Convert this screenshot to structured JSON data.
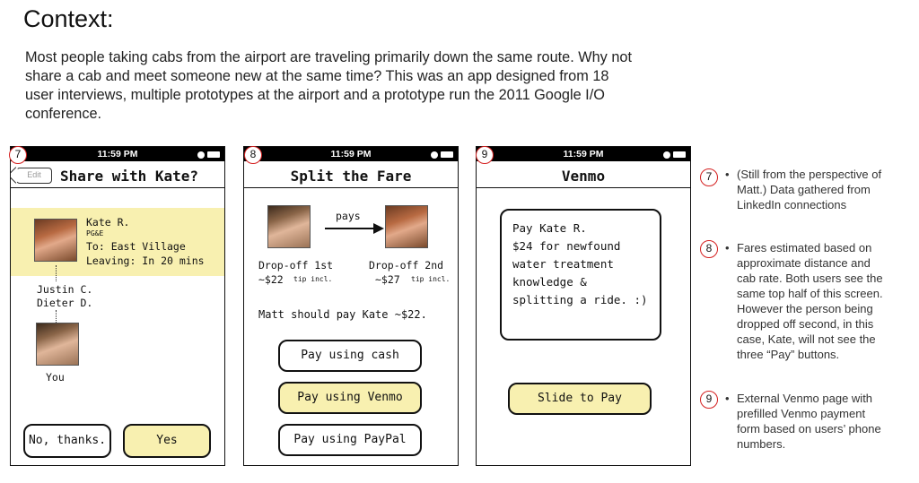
{
  "context": {
    "title": "Context:",
    "body": "Most people taking cabs from the airport are traveling primarily down the same route. Why not share a cab and meet someone new at the same time? This was an app designed from 18 user interviews, multiple prototypes at the airport and a prototype run the 2011 Google I/O conference."
  },
  "status_time": "11:59 PM",
  "screen7": {
    "number": "7",
    "edit_label": "Edit",
    "title": "Share with Kate?",
    "match_name": "Kate R.",
    "match_company": "PG&E",
    "match_dest": "To: East Village",
    "match_leaving": "Leaving: In 20 mins",
    "others_1": "Justin C.",
    "others_2": "Dieter D.",
    "you_label": "You",
    "decline_label": "No, thanks.",
    "accept_label": "Yes"
  },
  "screen8": {
    "number": "8",
    "title": "Split the Fare",
    "pays_label": "pays",
    "left_dropoff": "Drop-off 1st",
    "left_fare": "~$22",
    "right_dropoff": "Drop-off 2nd",
    "right_fare": "~$27",
    "tip_note": "tip incl.",
    "summary": "Matt should pay Kate ~$22.",
    "cash_label": "Pay using cash",
    "venmo_label": "Pay using Venmo",
    "paypal_label": "Pay using PayPal"
  },
  "screen9": {
    "number": "9",
    "title": "Venmo",
    "message_lines": [
      "Pay Kate R.",
      "$24 for newfound",
      "water treatment",
      "knowledge &",
      "splitting a ride. :)"
    ],
    "slide_label": "Slide to Pay"
  },
  "notes": [
    {
      "number": "7",
      "bullet": "•",
      "text": "(Still from the perspective of Matt.) Data gathered from LinkedIn connections"
    },
    {
      "number": "8",
      "bullet": "•",
      "text": "Fares estimated based on approximate distance and cab rate. Both users see the same top half of this screen. However the person being dropped off second, in this case, Kate, will not see the three “Pay” buttons."
    },
    {
      "number": "9",
      "bullet": "•",
      "text": "External Venmo page with prefilled Venmo payment form based on users’ phone numbers."
    }
  ]
}
